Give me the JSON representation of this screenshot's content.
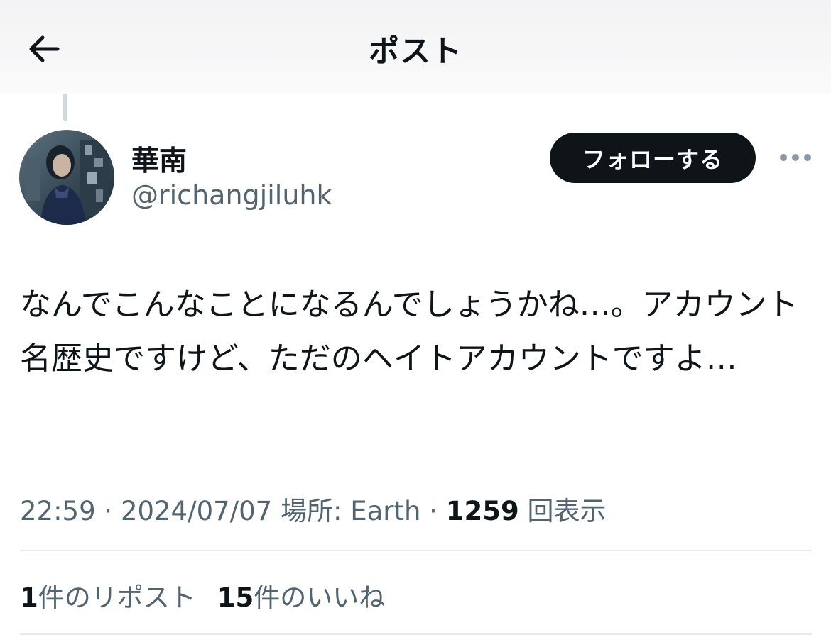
{
  "header": {
    "title": "ポスト"
  },
  "author": {
    "display_name": "華南",
    "handle": "@richangjiluhk"
  },
  "actions": {
    "follow_label": "フォローする"
  },
  "post": {
    "text": "なんでこんなことになるんでしょうかね…。アカウント名歴史ですけど、ただのヘイトアカウントですよ…"
  },
  "meta": {
    "time": "22:59",
    "sep1": " · ",
    "date": "2024/07/07",
    "location": " 場所: Earth",
    "sep2": " · ",
    "views_count": "1259",
    "views_label": " 回表示"
  },
  "stats": {
    "reposts_count": "1",
    "reposts_label": "件のリポスト",
    "likes_count": "15",
    "likes_label": "件のいいね"
  },
  "icons": {
    "back": "arrow-left-icon",
    "more": "more-horizontal-icon"
  }
}
